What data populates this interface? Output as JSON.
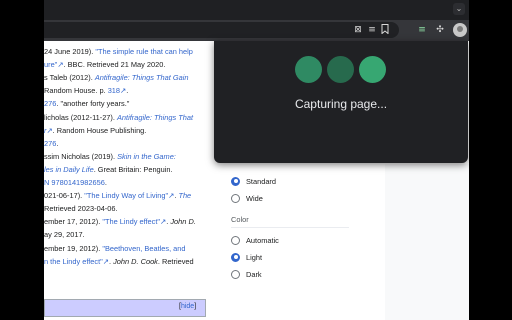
{
  "browser": {
    "tabstrip_button": "⌄",
    "toolbar_icons": [
      "⊠",
      "≡",
      "🔖",
      "≡",
      "✣"
    ]
  },
  "article": {
    "lines": [
      {
        "parts": [
          {
            "t": "24 June 2019). ",
            "s": ""
          },
          {
            "t": "\"The simple rule that can help",
            "s": "lnk"
          }
        ]
      },
      {
        "parts": [
          {
            "t": "ure\"",
            "s": "lnk"
          },
          {
            "t": "↗",
            "s": "lnk"
          },
          {
            "t": ". BBC. Retrieved 21 May 2020.",
            "s": ""
          }
        ]
      },
      {
        "parts": [
          {
            "t": "s Taleb (2012). ",
            "s": ""
          },
          {
            "t": "Antifragile: Things That Gain",
            "s": "ilnk"
          }
        ]
      },
      {
        "parts": [
          {
            "t": "Random House. p. ",
            "s": ""
          },
          {
            "t": "318",
            "s": "lnk"
          },
          {
            "t": "↗",
            "s": "lnk"
          },
          {
            "t": ".",
            "s": ""
          }
        ]
      },
      {
        "parts": [
          {
            "t": "276",
            "s": "lnk"
          },
          {
            "t": ". \"another forty years.\"",
            "s": ""
          }
        ]
      },
      {
        "parts": [
          {
            "t": "licholas (2012-11-27). ",
            "s": ""
          },
          {
            "t": "Antifragile: Things That",
            "s": "ilnk"
          }
        ]
      },
      {
        "parts": [
          {
            "t": "r",
            "s": "ilnk"
          },
          {
            "t": "↗",
            "s": "lnk"
          },
          {
            "t": ". Random House Publishing.",
            "s": ""
          }
        ]
      },
      {
        "parts": [
          {
            "t": "276",
            "s": "lnk"
          },
          {
            "t": ".",
            "s": ""
          }
        ]
      },
      {
        "parts": [
          {
            "t": "ssim Nicholas (2019). ",
            "s": ""
          },
          {
            "t": "Skin in the Game:",
            "s": "ilnk"
          }
        ]
      },
      {
        "parts": [
          {
            "t": "les in Daily Life",
            "s": "ilnk"
          },
          {
            "t": ". Great Britain: Penguin.",
            "s": ""
          }
        ]
      },
      {
        "parts": [
          {
            "t": "N 9780141982656",
            "s": "lnk"
          },
          {
            "t": ".",
            "s": ""
          }
        ]
      },
      {
        "parts": [
          {
            "t": "021-06-17). ",
            "s": ""
          },
          {
            "t": "\"The Lindy Way of Living\"",
            "s": "lnk"
          },
          {
            "t": "↗",
            "s": "lnk"
          },
          {
            "t": ". ",
            "s": ""
          },
          {
            "t": "The",
            "s": "ilnk"
          }
        ]
      },
      {
        "parts": [
          {
            "t": "Retrieved 2023-04-06.",
            "s": ""
          }
        ]
      },
      {
        "parts": [
          {
            "t": "ember 17, 2012). ",
            "s": ""
          },
          {
            "t": "\"The Lindy effect\"",
            "s": "lnk"
          },
          {
            "t": "↗",
            "s": "lnk"
          },
          {
            "t": ". ",
            "s": ""
          },
          {
            "t": "John D.",
            "s": "it"
          }
        ]
      },
      {
        "parts": [
          {
            "t": "ay 29, 2017.",
            "s": ""
          }
        ]
      },
      {
        "parts": [
          {
            "t": "ember 19, 2012). ",
            "s": ""
          },
          {
            "t": "\"Beethoven, Beatles, and",
            "s": "lnk"
          }
        ]
      },
      {
        "parts": [
          {
            "t": "n the Lindy effect\"",
            "s": "lnk"
          },
          {
            "t": "↗",
            "s": "lnk"
          },
          {
            "t": ". ",
            "s": ""
          },
          {
            "t": "John D. Cook",
            "s": "it"
          },
          {
            "t": ". Retrieved",
            "s": ""
          }
        ]
      }
    ],
    "navbox_hide_open": "[",
    "navbox_hide": "hide",
    "navbox_hide_close": "]"
  },
  "appearance": {
    "width_options": [
      {
        "label": "Standard",
        "checked": true
      },
      {
        "label": "Wide",
        "checked": false
      }
    ],
    "color_heading": "Color",
    "color_options": [
      {
        "label": "Automatic",
        "checked": false
      },
      {
        "label": "Light",
        "checked": true
      },
      {
        "label": "Dark",
        "checked": false
      }
    ]
  },
  "capture": {
    "label": "Capturing page...",
    "dot_colors": [
      "#2f8a63",
      "#276a4d",
      "#37a772"
    ]
  }
}
